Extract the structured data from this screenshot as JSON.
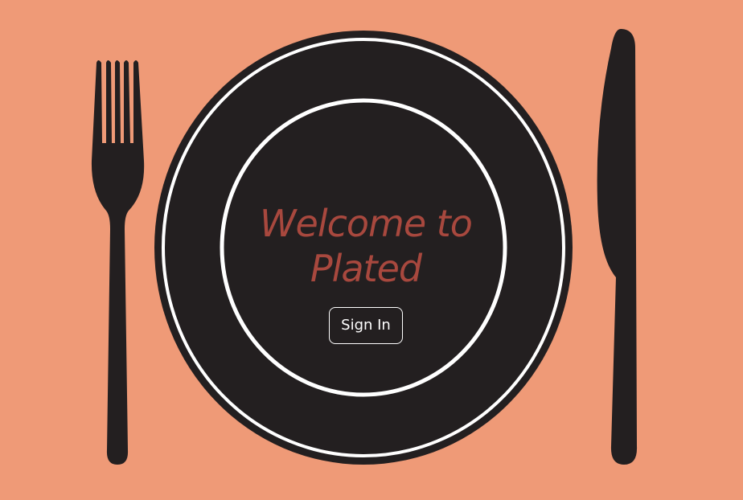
{
  "page": {
    "background_color": "#ef9a77",
    "plate_color": "#231f20",
    "rim_color": "#ffffff",
    "title_color": "#a8483e"
  },
  "hero": {
    "title_line1": "Welcome to",
    "title_line2": "Plated"
  },
  "actions": {
    "sign_in_label": "Sign In"
  },
  "icons": {
    "fork": "fork-icon",
    "plate": "plate-icon",
    "knife": "knife-icon"
  }
}
